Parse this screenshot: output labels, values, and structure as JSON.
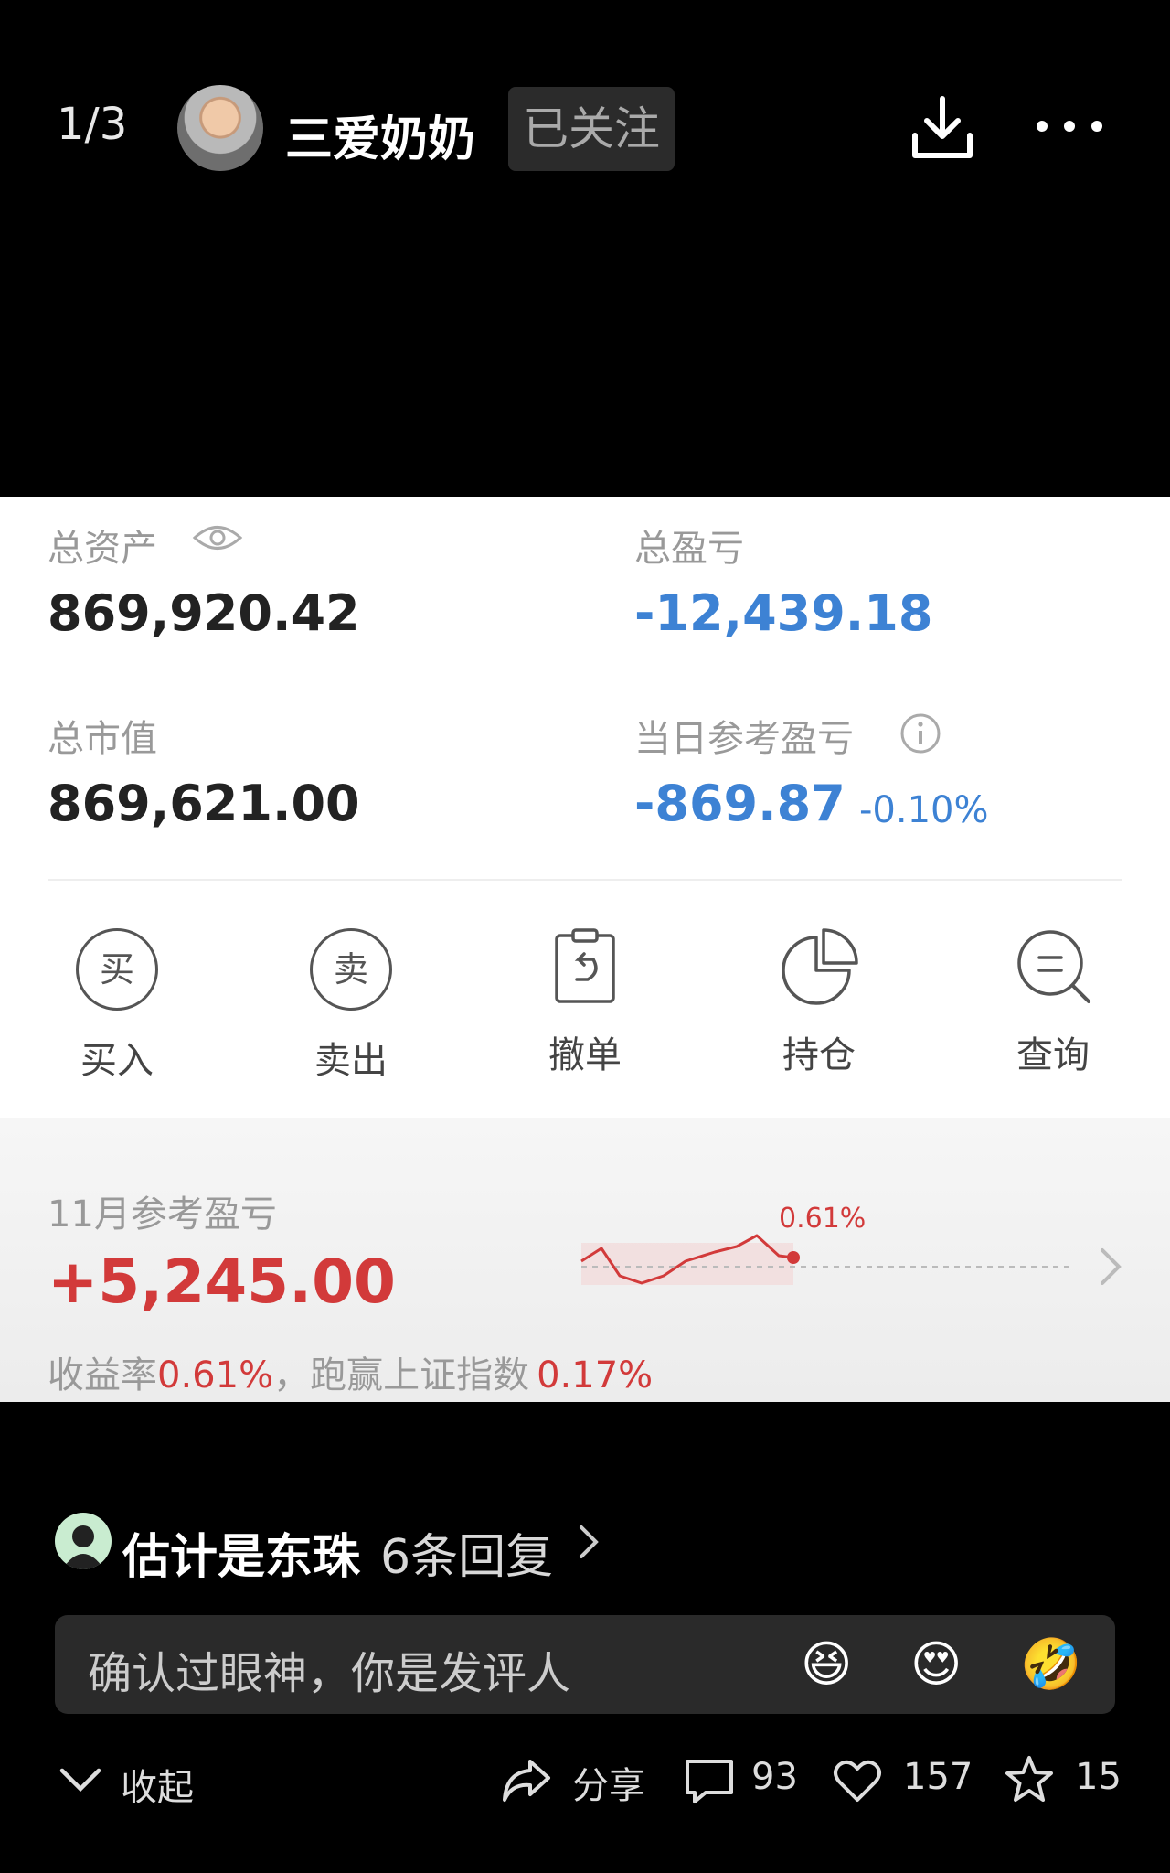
{
  "header": {
    "pager": "1/3",
    "username": "三爱奶奶",
    "follow_label": "已关注"
  },
  "assets": {
    "total_assets_label": "总资产",
    "total_assets_value": "869,920.42",
    "total_pl_label": "总盈亏",
    "total_pl_value": "-12,439.18",
    "market_value_label": "总市值",
    "market_value_value": "869,621.00",
    "daily_pl_label": "当日参考盈亏",
    "daily_pl_value": "-869.87",
    "daily_pl_pct": "-0.10%"
  },
  "actions": [
    {
      "icon_text": "买",
      "label": "买入"
    },
    {
      "icon_text": "卖",
      "label": "卖出"
    },
    {
      "label": "撤单"
    },
    {
      "label": "持仓"
    },
    {
      "label": "查询"
    }
  ],
  "monthly": {
    "label": "11月参考盈亏",
    "value": "+5,245.00",
    "return_label": "收益率",
    "return_value": "0.61%",
    "sep": "，",
    "beat_label": "跑赢上证指数",
    "beat_value": "0.17%",
    "spark_label": "0.61%"
  },
  "comment": {
    "reply_name": "估计是东珠",
    "reply_count": "6条回复",
    "input_text": "确认过眼神，你是发评人",
    "emojis": [
      "😆",
      "😍",
      "🤣"
    ]
  },
  "footer": {
    "collapse_label": "收起",
    "share_label": "分享",
    "comments_count": "93",
    "likes_count": "157",
    "favorites_count": "15"
  },
  "colors": {
    "negative_blue": "#3d82d4",
    "positive_red": "#d23a3a"
  }
}
